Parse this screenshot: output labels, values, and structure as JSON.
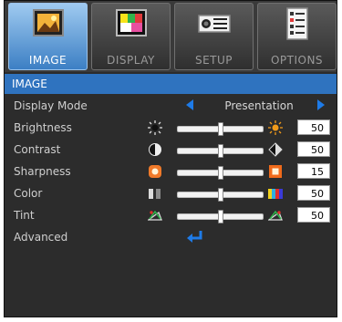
{
  "tabs": [
    {
      "label": "IMAGE",
      "icon": "image-icon",
      "active": true
    },
    {
      "label": "DISPLAY",
      "icon": "display-icon",
      "active": false
    },
    {
      "label": "SETUP",
      "icon": "projector-icon",
      "active": false
    },
    {
      "label": "OPTIONS",
      "icon": "options-icon",
      "active": false
    }
  ],
  "section_title": "IMAGE",
  "display_mode": {
    "label": "Display Mode",
    "value": "Presentation"
  },
  "settings": [
    {
      "label": "Brightness",
      "value": "50",
      "level": 0.5,
      "left_icon": "sun-dim-icon",
      "right_icon": "sun-bright-icon"
    },
    {
      "label": "Contrast",
      "value": "50",
      "level": 0.5,
      "left_icon": "contrast-low-icon",
      "right_icon": "contrast-high-icon"
    },
    {
      "label": "Sharpness",
      "value": "15",
      "level": 0.5,
      "left_icon": "sharpness-low-icon",
      "right_icon": "sharpness-high-icon"
    },
    {
      "label": "Color",
      "value": "50",
      "level": 0.5,
      "left_icon": "color-low-icon",
      "right_icon": "color-high-icon"
    },
    {
      "label": "Tint",
      "value": "50",
      "level": 0.5,
      "left_icon": "tint-low-icon",
      "right_icon": "tint-high-icon"
    }
  ],
  "advanced": {
    "label": "Advanced",
    "icon": "enter-icon"
  },
  "colors": {
    "accent": "#2f73bf",
    "arrow": "#1e7be8",
    "background": "#2c2c2c"
  }
}
